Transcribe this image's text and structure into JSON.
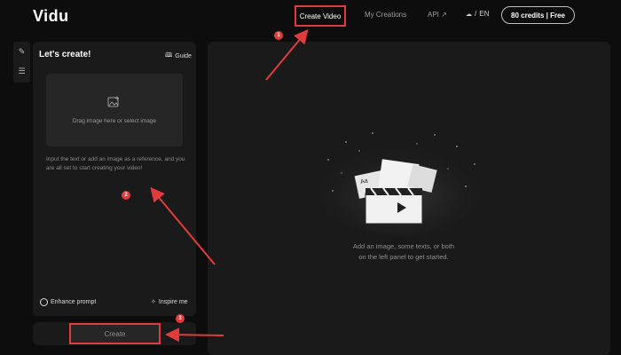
{
  "header": {
    "logo": "Vidu",
    "nav": {
      "create_video": "Create Video",
      "my_creations": "My Creations",
      "api": "API ↗"
    },
    "language": "EN",
    "credits": "80 credits | Free"
  },
  "left_panel": {
    "title": "Let's create!",
    "guide": "Guide",
    "dropzone_text": "Drag image here or select image",
    "hint": "Input the text or add an image as a reference, and you are all set to start creating your video!",
    "enhance_prompt": "Enhance prompt",
    "inspire_me": "Inspire me",
    "create_button": "Create"
  },
  "canvas": {
    "empty_line1": "Add an image, some texts, or both",
    "empty_line2": "on the left panel to get started."
  },
  "annotations": {
    "badge_1": "1",
    "badge_2": "2",
    "badge_3": "3",
    "color": "#e23b3b"
  }
}
